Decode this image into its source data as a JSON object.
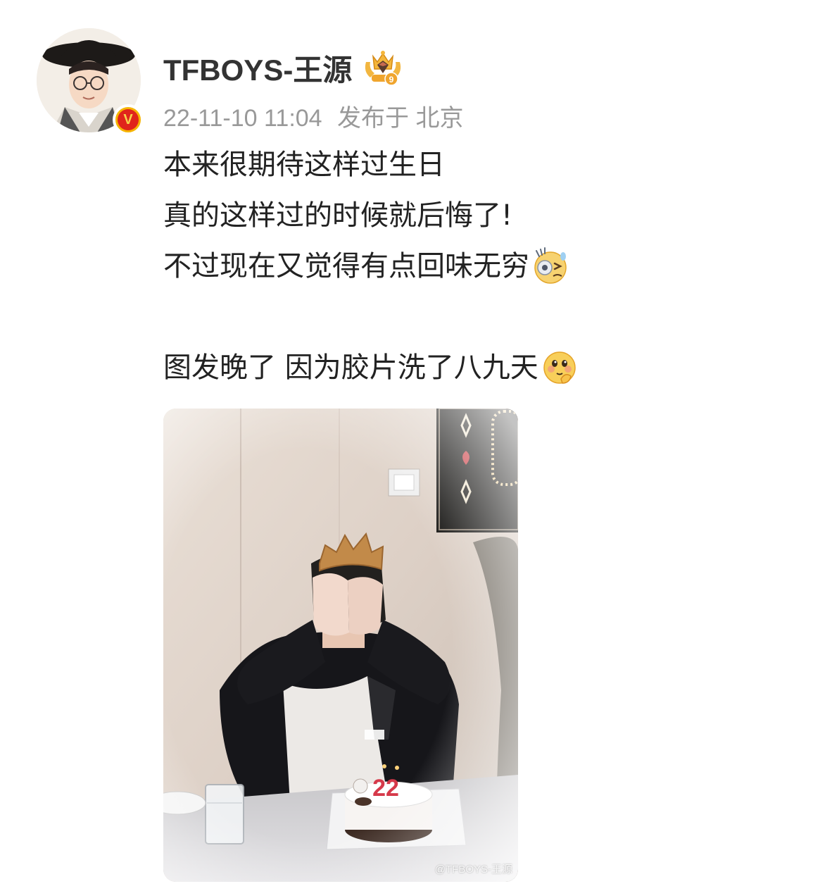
{
  "user": {
    "name": "TFBOYS-王源",
    "rank_icon": "crown-rank-icon",
    "verified_icon": "verified-v-icon",
    "verified_letter": "V"
  },
  "post": {
    "date": "22-11-10 11:04",
    "location_label": "发布于 北京",
    "lines": [
      "本来很期待这样过生日",
      "真的这样过的时候就后悔了!",
      "不过现在又觉得有点回味无穷",
      "",
      "图发晚了 因为胶片洗了八九天"
    ],
    "emoji_1": "awkward-sweat-emoji",
    "emoji_2": "shy-thinking-emoji"
  },
  "photo": {
    "cake_number": "22",
    "watermark": "@TFBOYS-王源"
  },
  "colors": {
    "name": "#333333",
    "meta": "#999999",
    "text": "#222222",
    "badge_red": "#e0241b",
    "badge_gold": "#f6b400"
  }
}
